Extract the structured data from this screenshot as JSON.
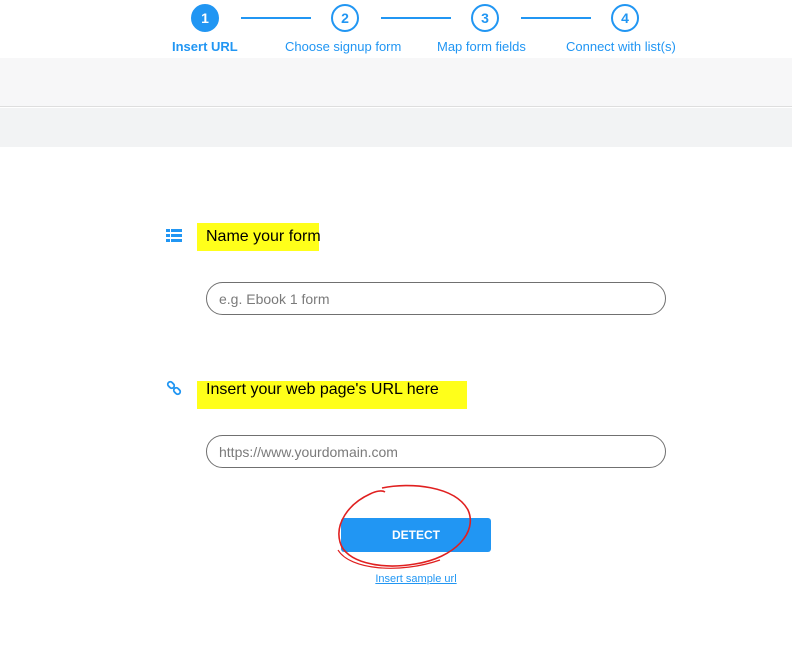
{
  "stepper": {
    "steps": [
      {
        "number": "1",
        "label": "Insert URL",
        "active": true
      },
      {
        "number": "2",
        "label": "Choose signup form",
        "active": false
      },
      {
        "number": "3",
        "label": "Map form fields",
        "active": false
      },
      {
        "number": "4",
        "label": "Connect with list(s)",
        "active": false
      }
    ]
  },
  "form": {
    "name_section": {
      "title": "Name your form",
      "icon": "list-icon",
      "input_value": "",
      "placeholder": "e.g. Ebook 1 form"
    },
    "url_section": {
      "title": "Insert your web page's URL here",
      "icon": "link-icon",
      "input_value": "",
      "placeholder": "https://www.yourdomain.com"
    },
    "detect_label": "DETECT",
    "sample_link_label": "Insert sample url"
  },
  "colors": {
    "accent": "#2196f3",
    "highlight": "#ffff1a",
    "annotation": "#e02020"
  }
}
